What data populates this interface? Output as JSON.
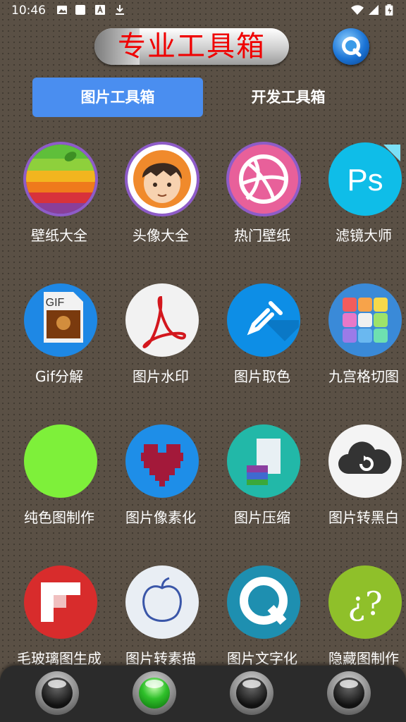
{
  "status_bar": {
    "time": "10:46"
  },
  "header": {
    "title": "专业工具箱"
  },
  "tabs": [
    {
      "label": "图片工具箱",
      "active": true
    },
    {
      "label": "开发工具箱",
      "active": false
    }
  ],
  "tools": [
    {
      "label": "壁纸大全",
      "icon": "apple-rainbow-icon"
    },
    {
      "label": "头像大全",
      "icon": "avatar-face-icon"
    },
    {
      "label": "热门壁纸",
      "icon": "dribbble-ball-icon"
    },
    {
      "label": "滤镜大师",
      "icon": "ps-icon"
    },
    {
      "label": "Gif分解",
      "icon": "gif-file-icon",
      "icon_text": "GIF"
    },
    {
      "label": "图片水印",
      "icon": "acrobat-icon"
    },
    {
      "label": "图片取色",
      "icon": "eyedropper-icon"
    },
    {
      "label": "九宫格切图",
      "icon": "nine-grid-photos-icon"
    },
    {
      "label": "纯色图制作",
      "icon": "solid-color-icon"
    },
    {
      "label": "图片像素化",
      "icon": "pixel-heart-icon"
    },
    {
      "label": "图片压缩",
      "icon": "compress-archive-icon"
    },
    {
      "label": "图片转黑白",
      "icon": "cloud-sync-icon"
    },
    {
      "label": "毛玻璃图生成",
      "icon": "flipboard-icon"
    },
    {
      "label": "图片转素描",
      "icon": "peach-sketch-icon"
    },
    {
      "label": "图片文字化",
      "icon": "q-letter-icon"
    },
    {
      "label": "隐藏图制作",
      "icon": "question-marks-icon"
    }
  ],
  "colors": {
    "accent": "#4a8ef0",
    "title_red": "#f00000",
    "background": "#5a5045",
    "active_nav": "#2fc02a"
  },
  "bottom_nav": [
    {
      "name": "nav-1",
      "active": false
    },
    {
      "name": "nav-2",
      "active": true
    },
    {
      "name": "nav-3",
      "active": false
    },
    {
      "name": "nav-4",
      "active": false
    }
  ]
}
